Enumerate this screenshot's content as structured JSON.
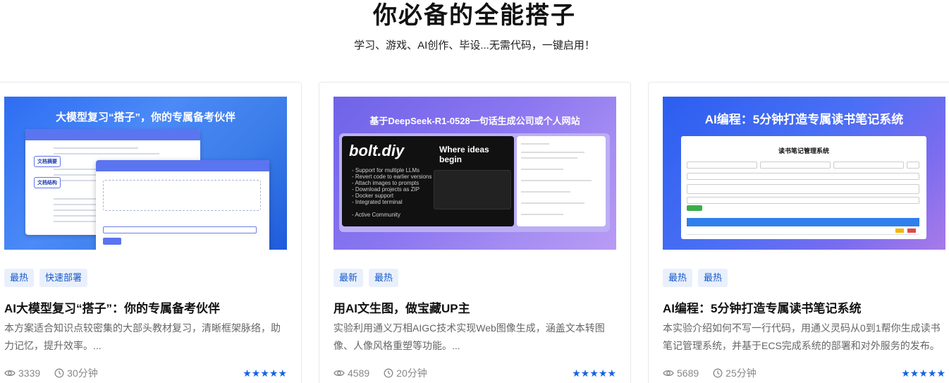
{
  "page": {
    "heading": "你必备的全能搭子",
    "subheading": "学习、游戏、AI创作、毕设...无需代码，一键启用！"
  },
  "cards": [
    {
      "thumb_caption": "大模型复习“搭子”，你的专属备考伙伴",
      "thumb_label_a": "文档摘要",
      "thumb_label_b": "文档结构",
      "tags": [
        "最热",
        "快速部署"
      ],
      "title": "AI大模型复习“搭子”：你的专属备考伙伴",
      "desc": " 本方案适合知识点较密集的大部头教材复习，清晰框架脉络，助力记忆，提升效率。...",
      "views": "3339",
      "duration": "30分钟",
      "rating": 5
    },
    {
      "thumb_caption": "基于DeepSeek-R1-0528一句话生成公司或个人网站",
      "thumb_logo": "bolt.diy",
      "thumb_tagline": "Where ideas begin",
      "thumb_features": "- Support for multiple LLMs\n- Revert code to earlier versions\n- Attach images to prompts\n- Download projects as ZIP\n- Docker support\n- Integrated terminal\n\n- Active Community",
      "tags": [
        "最新",
        "最热"
      ],
      "title": "用AI文生图，做宝藏UP主",
      "desc": " 实验利用通义万相AIGC技术实现Web图像生成，涵盖文本转图像、人像风格重塑等功能。...",
      "views": "4589",
      "duration": "20分钟",
      "rating": 5
    },
    {
      "thumb_caption": "AI编程：5分钟打造专属读书笔记系统",
      "thumb_panel_title": "读书笔记管理系统",
      "tags": [
        "最热",
        "最热"
      ],
      "title": "AI编程：5分钟打造专属读书笔记系统",
      "desc": "本实验介绍如何不写一行代码，用通义灵码从0到1帮你生成读书笔记管理系统，并基于ECS完成系统的部署和对外服务的发布。",
      "views": "5689",
      "duration": "25分钟",
      "rating": 5
    }
  ],
  "stars_text": "★★★★★",
  "colors": {
    "accent": "#1463e0",
    "tag_bg": "#e9f0fc"
  }
}
